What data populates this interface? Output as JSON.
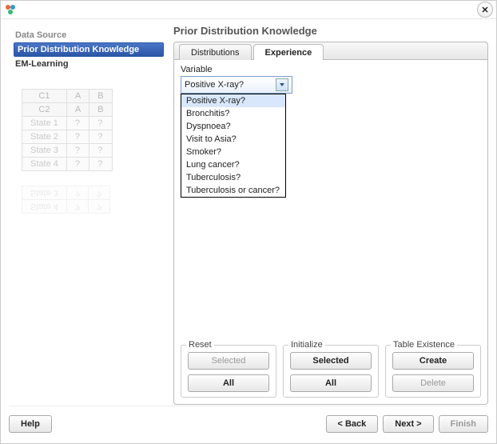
{
  "window": {
    "close_glyph": "✕"
  },
  "sidebar": {
    "steps": [
      {
        "label": "Data Source"
      },
      {
        "label": "Prior Distribution Knowledge"
      },
      {
        "label": "EM-Learning"
      }
    ],
    "ghost": {
      "c1": "C1",
      "c2": "C2",
      "a": "A",
      "b": "B",
      "rows": [
        "State 1",
        "State 2",
        "State 3",
        "State 4"
      ],
      "q": "?"
    }
  },
  "page": {
    "title": "Prior Distribution Knowledge"
  },
  "tabs": {
    "distributions": "Distributions",
    "experience": "Experience"
  },
  "variable": {
    "label": "Variable",
    "value": "Positive X-ray?",
    "options": [
      "Positive X-ray?",
      "Bronchitis?",
      "Dyspnoea?",
      "Visit to Asia?",
      "Smoker?",
      "Lung cancer?",
      "Tuberculosis?",
      "Tuberculosis or cancer?"
    ]
  },
  "groups": {
    "reset": {
      "legend": "Reset",
      "selected": "Selected",
      "all": "All"
    },
    "initialize": {
      "legend": "Initialize",
      "selected": "Selected",
      "all": "All"
    },
    "existence": {
      "legend": "Table Existence",
      "create": "Create",
      "delete": "Delete"
    }
  },
  "footer": {
    "help": "Help",
    "back": "< Back",
    "next": "Next >",
    "finish": "Finish"
  }
}
